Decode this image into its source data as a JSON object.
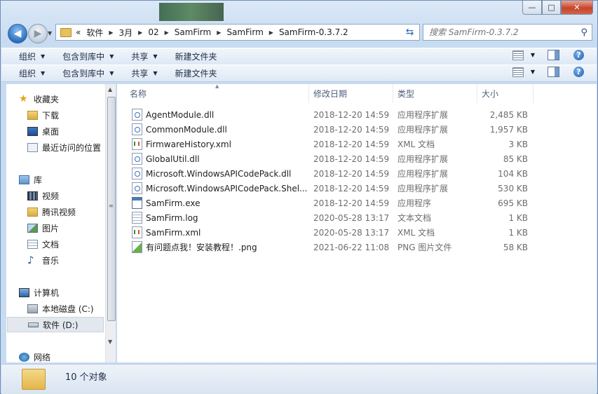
{
  "window": {
    "caption_buttons": {
      "minimize": "—",
      "maximize": "□",
      "close": "✕"
    }
  },
  "address_bar": {
    "overflow": "«",
    "breadcrumbs": [
      "软件",
      "3月",
      "02",
      "SamFirm",
      "SamFirm",
      "SamFirm-0.3.7.2"
    ]
  },
  "search": {
    "placeholder": "搜索 SamFirm-0.3.7.2"
  },
  "toolbar": {
    "items": [
      "组织",
      "包含到库中",
      "共享",
      "新建文件夹"
    ]
  },
  "nav": {
    "favorites": {
      "label": "收藏夹",
      "items": [
        "下载",
        "桌面",
        "最近访问的位置"
      ]
    },
    "libraries": {
      "label": "库",
      "items": [
        "视频",
        "腾讯视频",
        "图片",
        "文档",
        "音乐"
      ]
    },
    "computer": {
      "label": "计算机",
      "items": [
        "本地磁盘 (C:)",
        "软件 (D:)"
      ]
    },
    "network": {
      "label": "网络"
    }
  },
  "columns": {
    "name": "名称",
    "date": "修改日期",
    "type": "类型",
    "size": "大小"
  },
  "files": [
    {
      "name": "AgentModule.dll",
      "date": "2018-12-20 14:59",
      "type": "应用程序扩展",
      "size": "2,485 KB",
      "icon": "dll-icon"
    },
    {
      "name": "CommonModule.dll",
      "date": "2018-12-20 14:59",
      "type": "应用程序扩展",
      "size": "1,957 KB",
      "icon": "dll-icon"
    },
    {
      "name": "FirmwareHistory.xml",
      "date": "2018-12-20 14:59",
      "type": "XML 文档",
      "size": "3 KB",
      "icon": "xml-icon"
    },
    {
      "name": "GlobalUtil.dll",
      "date": "2018-12-20 14:59",
      "type": "应用程序扩展",
      "size": "85 KB",
      "icon": "dll-icon"
    },
    {
      "name": "Microsoft.WindowsAPICodePack.dll",
      "date": "2018-12-20 14:59",
      "type": "应用程序扩展",
      "size": "104 KB",
      "icon": "dll-icon"
    },
    {
      "name": "Microsoft.WindowsAPICodePack.Shel...",
      "date": "2018-12-20 14:59",
      "type": "应用程序扩展",
      "size": "530 KB",
      "icon": "dll-icon"
    },
    {
      "name": "SamFirm.exe",
      "date": "2018-12-20 14:59",
      "type": "应用程序",
      "size": "695 KB",
      "icon": "exe-icon"
    },
    {
      "name": "SamFirm.log",
      "date": "2020-05-28 13:17",
      "type": "文本文档",
      "size": "1 KB",
      "icon": "log-icon"
    },
    {
      "name": "SamFirm.xml",
      "date": "2020-05-28 13:17",
      "type": "XML 文档",
      "size": "1 KB",
      "icon": "xml-icon"
    },
    {
      "name": "有问题点我！安装教程！.png",
      "date": "2021-06-22 11:08",
      "type": "PNG 图片文件",
      "size": "58 KB",
      "icon": "png-icon"
    }
  ],
  "status": {
    "text": "10 个对象"
  }
}
